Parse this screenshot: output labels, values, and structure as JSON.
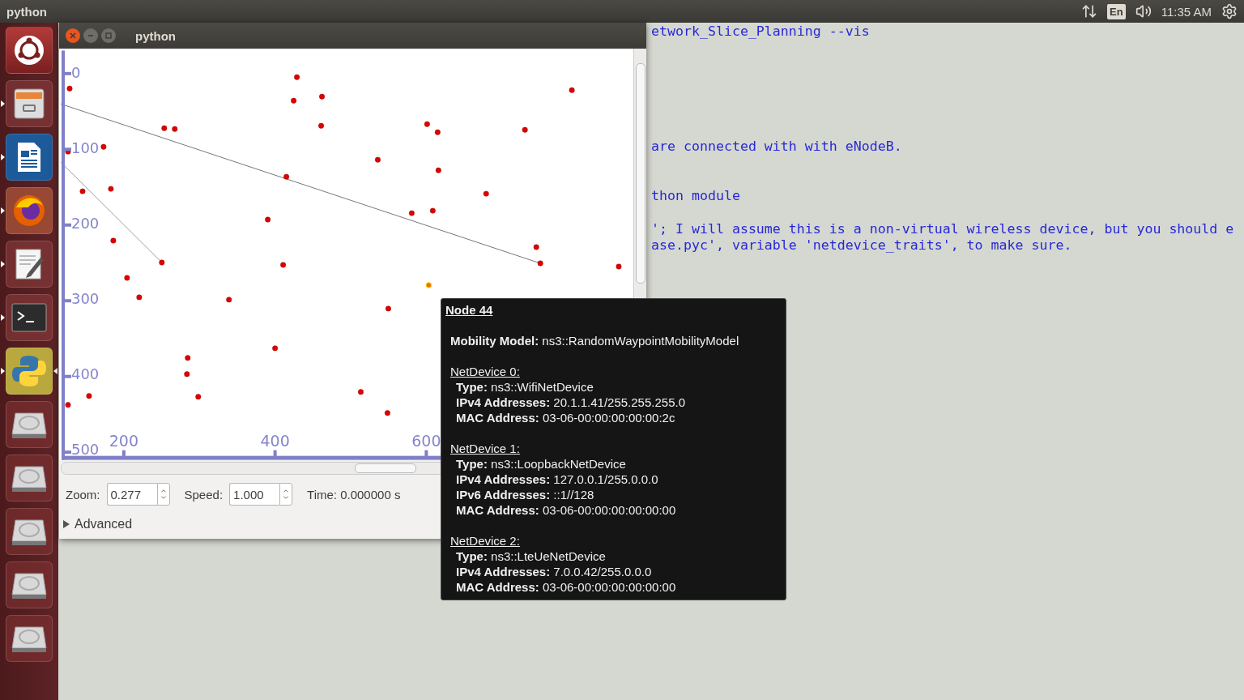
{
  "top_bar": {
    "app_title": "python",
    "keyboard": "En",
    "clock": "11:35 AM"
  },
  "dock": [
    {
      "kind": "ubuntu",
      "running": false,
      "active": false
    },
    {
      "kind": "files",
      "running": true,
      "active": false
    },
    {
      "kind": "writer",
      "running": true,
      "active": false
    },
    {
      "kind": "browser",
      "running": true,
      "active": false
    },
    {
      "kind": "editor",
      "running": true,
      "active": false
    },
    {
      "kind": "terminal",
      "running": true,
      "active": false
    },
    {
      "kind": "python",
      "running": true,
      "active": true
    },
    {
      "kind": "drive",
      "running": false,
      "active": false
    },
    {
      "kind": "drive",
      "running": false,
      "active": false
    },
    {
      "kind": "drive",
      "running": false,
      "active": false
    },
    {
      "kind": "drive",
      "running": false,
      "active": false
    },
    {
      "kind": "drive",
      "running": false,
      "active": false
    }
  ],
  "terminal": {
    "lines": [
      "etwork_Slice_Planning --vis",
      "are connected with with eNodeB.",
      "thon module",
      "'; I will assume this is a non-virtual wireless device, but you should e",
      "ase.pyc', variable 'netdevice_traits', to make sure."
    ]
  },
  "window": {
    "title": "python",
    "plot": {
      "y_ticks": [
        "0",
        "100",
        "200",
        "300",
        "400",
        "500"
      ],
      "x_ticks": [
        "200",
        "400",
        "600"
      ]
    },
    "zoom": {
      "label": "Zoom:",
      "value": "0.277"
    },
    "speed": {
      "label": "Speed:",
      "value": "1.000"
    },
    "time": "Time: 0.000000 s",
    "advanced": {
      "label": "Advanced",
      "expanded": false
    }
  },
  "tooltip": {
    "title": "Node 44",
    "mobility": {
      "label": "Mobility Model:",
      "value": "ns3::RandomWaypointMobilityModel"
    },
    "devices": [
      {
        "header": "NetDevice 0:",
        "fields": [
          {
            "label": "Type:",
            "value": "ns3::WifiNetDevice"
          },
          {
            "label": "IPv4 Addresses:",
            "value": "20.1.1.41/255.255.255.0"
          },
          {
            "label": "MAC Address:",
            "value": "03-06-00:00:00:00:00:2c"
          }
        ]
      },
      {
        "header": "NetDevice 1:",
        "fields": [
          {
            "label": "Type:",
            "value": "ns3::LoopbackNetDevice"
          },
          {
            "label": "IPv4 Addresses:",
            "value": "127.0.0.1/255.0.0.0"
          },
          {
            "label": "IPv6 Addresses:",
            "value": "::1//128"
          },
          {
            "label": "MAC Address:",
            "value": "03-06-00:00:00:00:00:00"
          }
        ]
      },
      {
        "header": "NetDevice 2:",
        "fields": [
          {
            "label": "Type:",
            "value": "ns3::LteUeNetDevice"
          },
          {
            "label": "IPv4 Addresses:",
            "value": "7.0.0.42/255.0.0.0"
          },
          {
            "label": "MAC Address:",
            "value": "03-06-00:00:00:00:00:00"
          }
        ]
      }
    ]
  }
}
